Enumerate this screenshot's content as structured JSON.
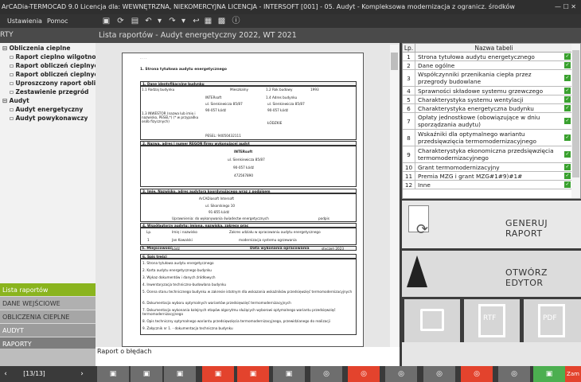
{
  "window": {
    "title": "ArCADia-TERMOCAD 9.0 Licencja dla: WEWNĘTRZNA, NIEKOMERCYJNA LICENCJA - INTERSOFT [001] - 05. Audyt - Kompleksowa modernizacja z ogranicz. środków",
    "controls": "—  ☐  ✕"
  },
  "menu": {
    "settings": "Ustawienia",
    "help": "Pomoc"
  },
  "header": {
    "left_partial": "RTY",
    "title": "Lista raportów - Audyt energetyczny 2022, WT 2021"
  },
  "tree": {
    "root": "Obliczenia cieplne",
    "items": [
      "Raport cieplno wilgotnoś",
      "Raport obliczeń cieplnycl",
      "Raport obliczeń cieplnych",
      "Uproszczony raport oblic",
      "Zestawienie przegród"
    ],
    "audit": "Audyt",
    "audit_items": [
      "Audyt energetyczny",
      "Audyt powykonawczy"
    ]
  },
  "nav": [
    "Lista raportów",
    "DANE WEJŚCIOWE",
    "OBLICZENIA CIEPLNE",
    "AUDYT",
    "RAPORTY"
  ],
  "report_label": "Raport o błędach",
  "footer": {
    "pager": "[13/13]",
    "close": "Zam"
  },
  "document": {
    "heading": "1. Strona tytułowa audytu energetycznego",
    "s1": "1. Dane identyfikacyjne budynku",
    "r11_label": "1.1 Rodzaj budynku",
    "r11_value": "Mieszkalny",
    "r12_label": "1.2 Rok budowy",
    "r12_value": "1993",
    "r13_label": "1.3 INWESTOR (nazwa lub imię i nazwisko, PESEL*) (* w przypadku osób fizycznych)",
    "r13_value_1": "INTERsoft",
    "r13_value_2": "ul. Sienkiewicza 85/87",
    "r13_value_3": "90-057 Łódź",
    "r13_value_4": "PESEL: 94050432111",
    "r14_label": "1.4 Adres budynku",
    "r14_value_1": "ul. Sienkiewicza 85/87",
    "r14_value_2": "90-057 Łódź",
    "r14_value_3": "ŁÓDZKIE",
    "s2": "2. Nazwa, adres i numer REGON firmy wykonującej audyt",
    "s2_v1": "INTERsoft",
    "s2_v2": "ul. Sienkiewicza 85/87",
    "s2_v3": "90-057 Łódź",
    "s2_v4": "472567890",
    "s3": "3. Imię, Nazwisko, adres audytora koordynującego wraz z podpisem",
    "s3_v1": "ArCADiasoft Intersoft",
    "s3_v2": "ul. Sikorskiego 10",
    "s3_v3": "91-855 Łódź",
    "s3_v4": "Uprawnienia: do wykonywania świadectw energetycznych",
    "s3_sign": "podpis",
    "s4": "4. Współautorzy audytu: imiona, nazwiska, zakresy prac",
    "s4_c1": "Lp.",
    "s4_c2": "Imię i nazwisko",
    "s4_c3": "Zakres udziału w opracowaniu audytu energetycznego",
    "s4_r1_1": "1",
    "s4_r1_2": "Jan Kowalski",
    "s4_r1_3": "modernizacja systemu ogrzewania",
    "s5": "5. Miejscowość",
    "s5_v": "Łódź",
    "s5_date_label": "Data wykonania opracowania",
    "s5_date": "styczeń 2023",
    "s6": "6. Spis treści",
    "toc": [
      "1. Strona tytułowa audytu energetycznego",
      "2. Karta audytu energetycznego budynku",
      "3. Wykaz dokumentów i danych źródłowych",
      "4. Inwentaryzacja techniczno-budowlana budynku",
      "5. Ocena stanu technicznego budynku w zakresie istotnym dla wskazania wskaźników przedsięwzięć termomodernizacyjnych",
      "6. Dokumentacja wyboru optymalnych wariantów przedsięwzięć termomodernizacyjnych",
      "7. Dokumentacja wykonania kolejnych etapów algorytmu służących wyborowi optymalnego wariantu przedsięwzięć termomodernizacyjnego",
      "8. Opis techniczny optymalnego wariantu przedsięwzięcia termomodernizacyjnego, przewidzianego do realizacji",
      "9. Załącznik nr 1. - dokumentacja techniczna budynku"
    ]
  },
  "table": {
    "col_lp": "Lp.",
    "col_name": "Nazwa tabeli",
    "rows": [
      {
        "n": "1",
        "t": "Strona tytułowa audytu energetycznego"
      },
      {
        "n": "2",
        "t": "Dane ogólne"
      },
      {
        "n": "3",
        "t": "Współczynniki przenikania ciepła przez przegrody budowlane"
      },
      {
        "n": "4",
        "t": "Sprawności składowe systemu grzewczego"
      },
      {
        "n": "5",
        "t": "Charakterystyka systemu wentylacji"
      },
      {
        "n": "6",
        "t": "Charakterystyka energetyczna budynku"
      },
      {
        "n": "7",
        "t": "Opłaty jednostkowe (obowiązujące w dniu sporządzania audytu)"
      },
      {
        "n": "8",
        "t": "Wskaźniki dla optymalnego wariantu przedsięwzięcia termomodernizacyjnego"
      },
      {
        "n": "9",
        "t": "Charakterystyka ekonomiczna przedsięwzięcia termomodernizacyjnego"
      },
      {
        "n": "10",
        "t": "Grant termomodernizacyjny"
      },
      {
        "n": "11",
        "t": "Premia MZG i grant MZG#1#9)#1#"
      },
      {
        "n": "12",
        "t": "Inne"
      }
    ]
  },
  "actions": {
    "generate": "GENERUJ RAPORT",
    "open_editor": "OTWÓRZ EDYTOR",
    "rtf": "RTF",
    "pdf": "PDF"
  },
  "colors": {
    "active_nav": "#8ab41e",
    "check": "#3aa12f",
    "footer_red": "#e3432d",
    "footer_green": "#4caf50"
  }
}
